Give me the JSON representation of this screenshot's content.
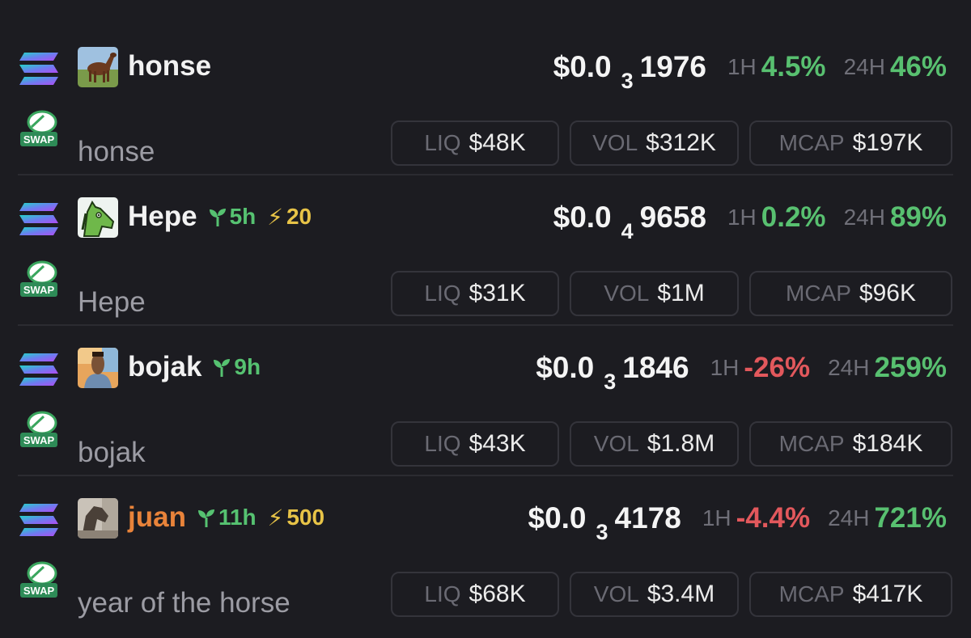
{
  "colors": {
    "background": "#1c1c21",
    "positive": "#58c070",
    "negative": "#e2585c",
    "boost": "#e7c347",
    "age": "#56c271",
    "highlight_name": "#e8833a"
  },
  "labels": {
    "h1": "1H",
    "h24": "24H",
    "liq": "LIQ",
    "vol": "VOL",
    "mcap": "MCAP",
    "swap": "SWAP",
    "boost_symbol": "⚡"
  },
  "tokens": [
    {
      "ticker": "honse",
      "name": "honse",
      "price_prefix": "$0.0",
      "price_zeros": "3",
      "price_digits": "1976",
      "change_1h": "4.5%",
      "change_24h": "46%",
      "liq": "$48K",
      "vol": "$312K",
      "mcap": "$197K",
      "avatar": "brown-horse-avatar"
    },
    {
      "ticker": "Hepe",
      "name": "Hepe",
      "age": "5h",
      "boost": "20",
      "price_prefix": "$0.0",
      "price_zeros": "4",
      "price_digits": "9658",
      "change_1h": "0.2%",
      "change_24h": "89%",
      "liq": "$31K",
      "vol": "$1M",
      "mcap": "$96K",
      "avatar": "green-horse-avatar"
    },
    {
      "ticker": "bojak",
      "name": "bojak",
      "age": "9h",
      "price_prefix": "$0.0",
      "price_zeros": "3",
      "price_digits": "1846",
      "change_1h": "-26%",
      "change_24h": "259%",
      "liq": "$43K",
      "vol": "$1.8M",
      "mcap": "$184K",
      "avatar": "cartoon-horse-avatar"
    },
    {
      "ticker": "juan",
      "name": "year of the horse",
      "age": "11h",
      "boost": "500",
      "price_prefix": "$0.0",
      "price_zeros": "3",
      "price_digits": "4178",
      "change_1h": "-4.4%",
      "change_24h": "721%",
      "liq": "$68K",
      "vol": "$3.4M",
      "mcap": "$417K",
      "avatar": "horse-photo-avatar"
    }
  ]
}
